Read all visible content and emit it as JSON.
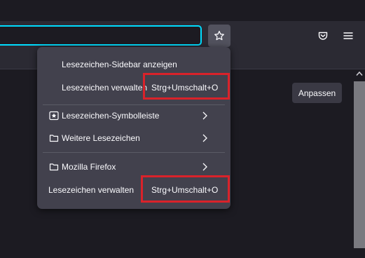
{
  "urlbar": {
    "placeholder": ""
  },
  "toolbar": {
    "star_icon": "star-icon",
    "pocket_icon": "pocket-icon",
    "menu_icon": "hamburger-menu-icon"
  },
  "content": {
    "customize_label": "Anpassen"
  },
  "bookmarks_menu": {
    "items": [
      {
        "label": "Lesezeichen-Sidebar anzeigen"
      },
      {
        "label": "Lesezeichen verwalten",
        "shortcut": "Strg+Umschalt+O"
      },
      {
        "label": "Lesezeichen-Symbolleiste",
        "icon": "bookmarks-toolbar-icon"
      },
      {
        "label": "Weitere Lesezeichen",
        "icon": "folder-icon"
      },
      {
        "label": "Mozilla Firefox",
        "icon": "folder-icon"
      },
      {
        "label": "Lesezeichen verwalten",
        "shortcut": "Strg+Umschalt+O"
      }
    ]
  },
  "colors": {
    "highlight": "#d9222a",
    "focus_ring": "#00ddff",
    "menu_bg": "#42414d"
  }
}
